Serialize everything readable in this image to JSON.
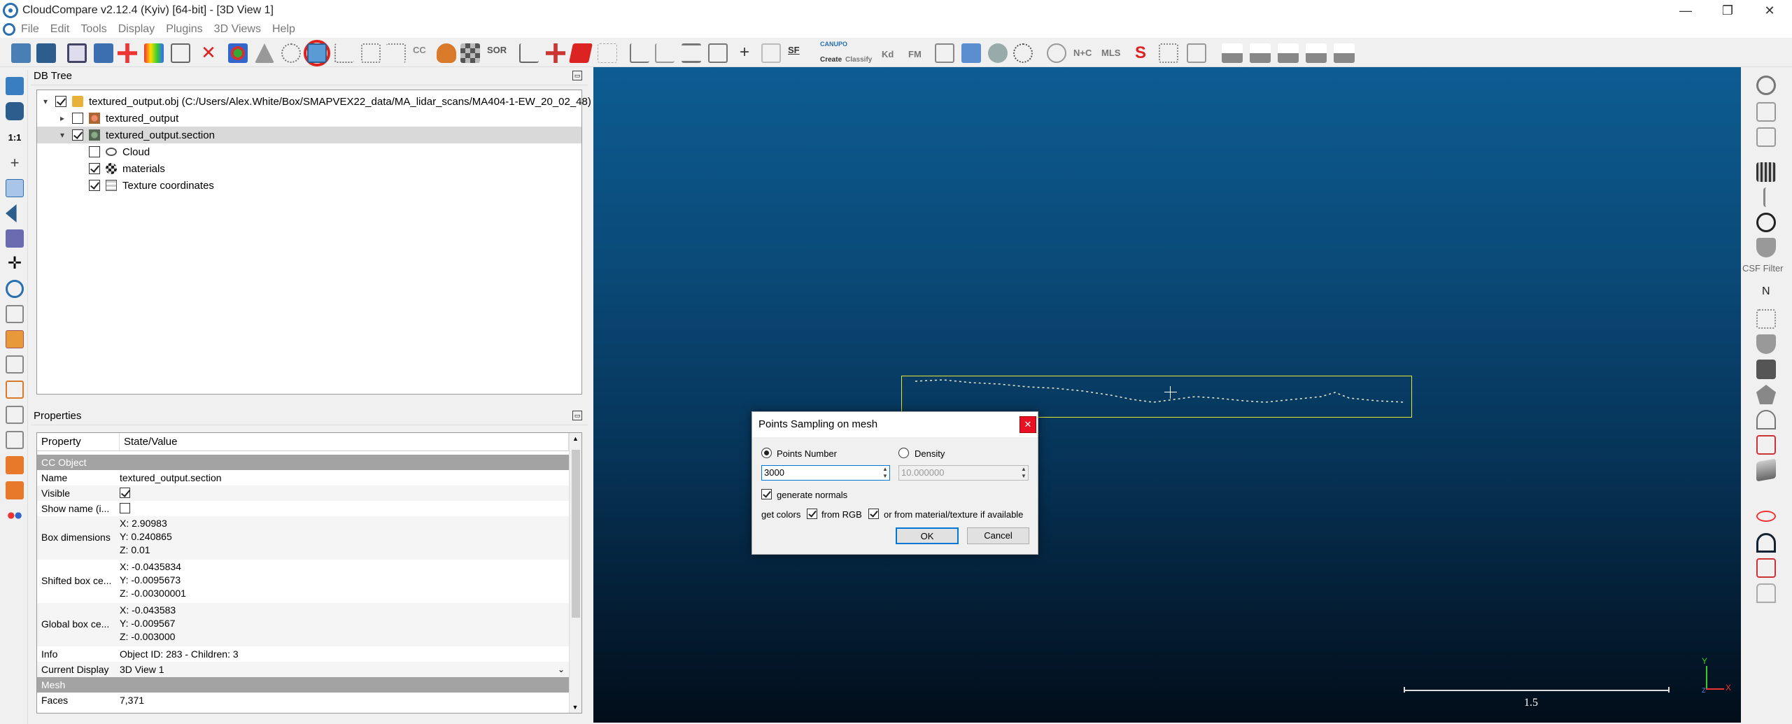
{
  "window": {
    "title": "CloudCompare v2.12.4 (Kyiv) [64-bit] - [3D View 1]",
    "minimize": "—",
    "maximize": "❐",
    "close": "✕"
  },
  "menu": [
    "File",
    "Edit",
    "Tools",
    "Display",
    "Plugins",
    "3D Views",
    "Help"
  ],
  "toolbar": {
    "labels": {
      "cc": "CC",
      "sor": "SOR",
      "sf": "SF",
      "canupo_create": "Create",
      "canupo_classify": "Classify",
      "canupo": "CANUPO",
      "kd": "Kd",
      "fm": "FM",
      "n_c": "N+C",
      "mls": "MLS"
    }
  },
  "dbtree": {
    "header": "DB Tree",
    "items": [
      {
        "label": "textured_output.obj (C:/Users/Alex.White/Box/SMAPVEX22_data/MA_lidar_scans/MA404-1-EW_20_02_48)",
        "arrow": "▾",
        "checked": true
      },
      {
        "label": "textured_output",
        "arrow": "▸",
        "checked": false
      },
      {
        "label": "textured_output.section",
        "arrow": "▾",
        "checked": true
      },
      {
        "label": "Cloud",
        "arrow": "",
        "checked": false
      },
      {
        "label": "materials",
        "arrow": "",
        "checked": true
      },
      {
        "label": "Texture coordinates",
        "arrow": "",
        "checked": true
      }
    ]
  },
  "properties": {
    "header": "Properties",
    "col_property": "Property",
    "col_value": "State/Value",
    "sections": {
      "cc_object": "CC Object",
      "mesh": "Mesh"
    },
    "name_label": "Name",
    "name_value": "textured_output.section",
    "visible_label": "Visible",
    "showname_label": "Show name (i...",
    "boxdim_label": "Box dimensions",
    "boxdim_x": "X: 2.90983",
    "boxdim_y": "Y: 0.240865",
    "boxdim_z": "Z: 0.01",
    "shifted_label": "Shifted box ce...",
    "shifted_x": "X: -0.0435834",
    "shifted_y": "Y: -0.0095673",
    "shifted_z": "Z: -0.00300001",
    "global_label": "Global box ce...",
    "global_x": "X: -0.043583",
    "global_y": "Y: -0.009567",
    "global_z": "Z: -0.003000",
    "info_label": "Info",
    "info_value": "Object ID: 283 - Children: 3",
    "display_label": "Current Display",
    "display_value": "3D View 1",
    "faces_label": "Faces",
    "faces_value": "7,371"
  },
  "view": {
    "scale_label": "1.5",
    "axis_x": "X",
    "axis_y": "Y",
    "axis_z": "Z"
  },
  "righttb": {
    "csf_label": "CSF Filter",
    "n_label": "N"
  },
  "dialog": {
    "title": "Points Sampling on mesh",
    "close": "✕",
    "points_number_label": "Points Number",
    "density_label": "Density",
    "points_value": "3000",
    "density_value": "10.000000",
    "generate_normals": "generate normals",
    "get_colors": "get colors",
    "from_rgb": "from RGB",
    "from_material": "or from material/texture if available",
    "ok": "OK",
    "cancel": "Cancel"
  },
  "colors": {
    "accent": "#0078d7",
    "view_top": "#0d5c92",
    "view_bottom": "#020d19",
    "bbox": "#e6e633",
    "highlight_circle": "#e0201a"
  }
}
